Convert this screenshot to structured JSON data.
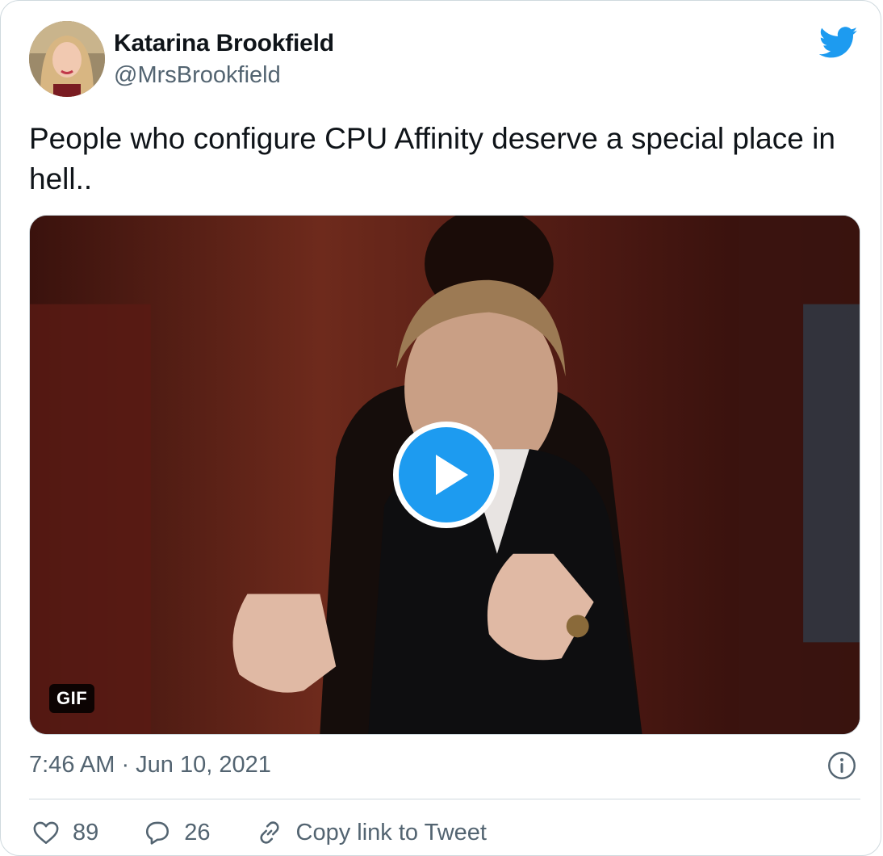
{
  "author": {
    "display_name": "Katarina Brookfield",
    "handle": "@MrsBrookfield",
    "avatar_icon": "profile-avatar"
  },
  "tweet": {
    "text": "People who configure CPU Affinity deserve a special place in hell..",
    "timestamp": "7:46 AM · Jun 10, 2021"
  },
  "media": {
    "badge": "GIF",
    "play_icon": "play-icon"
  },
  "actions": {
    "like_count": "89",
    "reply_count": "26",
    "copy_link_label": "Copy link to Tweet"
  },
  "colors": {
    "accent": "#1d9bf0",
    "secondary_text": "#536471",
    "border": "#cfd9de"
  }
}
